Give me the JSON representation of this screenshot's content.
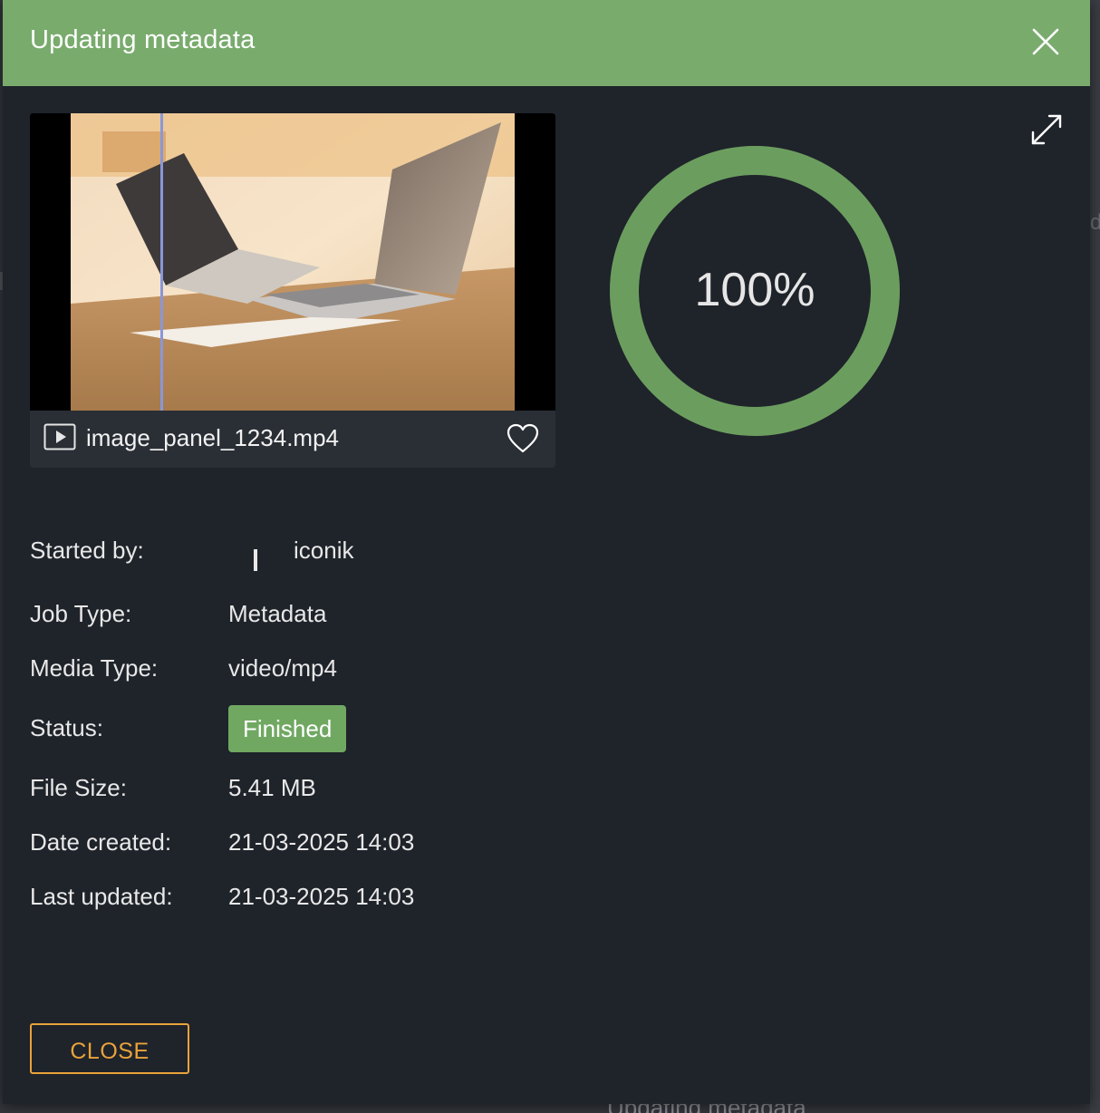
{
  "modal": {
    "title": "Updating metadata",
    "header_color": "#79ab6d"
  },
  "media": {
    "filename": "image_panel_1234.mp4",
    "type_icon": "video-play-icon",
    "favorite_icon": "heart-outline-icon"
  },
  "progress": {
    "value": 100,
    "label": "100%",
    "color": "#6b9e5e"
  },
  "details": {
    "started_by": {
      "label": "Started by:",
      "value": "iconik"
    },
    "job_type": {
      "label": "Job Type:",
      "value": "Metadata"
    },
    "media_type": {
      "label": "Media Type:",
      "value": "video/mp4"
    },
    "status": {
      "label": "Status:",
      "value": "Finished",
      "color": "#70a862"
    },
    "file_size": {
      "label": "File Size:",
      "value": "5.41 MB"
    },
    "date_created": {
      "label": "Date created:",
      "value": "21-03-2025 14:03"
    },
    "last_updated": {
      "label": "Last updated:",
      "value": "21-03-2025 14:03"
    }
  },
  "footer": {
    "close_label": "CLOSE",
    "close_color": "#e8a33a"
  },
  "background": {
    "peek_text": "Updating metadata",
    "peek_char": "d"
  }
}
